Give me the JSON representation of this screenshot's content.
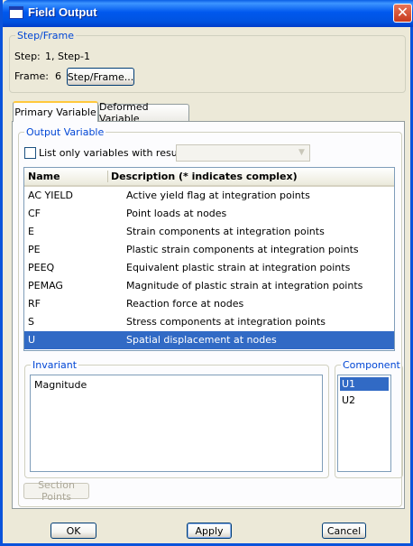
{
  "window": {
    "title": "Field Output",
    "close_glyph": "✕"
  },
  "step_frame": {
    "legend": "Step/Frame",
    "step_label": "Step:",
    "step_value": "1, Step-1",
    "frame_label": "Frame:",
    "frame_value": "6",
    "button": "Step/Frame..."
  },
  "tabs": [
    {
      "label": "Primary Variable",
      "active": true
    },
    {
      "label": "Deformed Variable",
      "active": false
    }
  ],
  "output_variable": {
    "legend": "Output Variable",
    "checkbox_label": "List only variables with results:",
    "checked": false,
    "combo_value": ""
  },
  "table": {
    "columns": [
      "Name",
      "Description (* indicates complex)"
    ],
    "rows": [
      {
        "name": "AC YIELD",
        "desc": "Active yield flag at integration points"
      },
      {
        "name": "CF",
        "desc": "Point loads at nodes"
      },
      {
        "name": "E",
        "desc": "Strain components at integration points"
      },
      {
        "name": "PE",
        "desc": "Plastic strain components at integration points"
      },
      {
        "name": "PEEQ",
        "desc": "Equivalent plastic strain at integration points"
      },
      {
        "name": "PEMAG",
        "desc": "Magnitude of plastic strain at integration points"
      },
      {
        "name": "RF",
        "desc": "Reaction force at nodes"
      },
      {
        "name": "S",
        "desc": "Stress components at integration points"
      },
      {
        "name": "U",
        "desc": "Spatial displacement at nodes"
      }
    ],
    "selected_index": 8
  },
  "invariant": {
    "legend": "Invariant",
    "items": [
      "Magnitude"
    ]
  },
  "component": {
    "legend": "Component",
    "items": [
      "U1",
      "U2"
    ],
    "selected_index": 0
  },
  "section_points_button": "Section Points",
  "footer": {
    "ok": "OK",
    "apply": "Apply",
    "cancel": "Cancel"
  },
  "colors": {
    "titlebar": "#0058EE",
    "selection": "#316AC5",
    "legend_text": "#0046D5",
    "dialog_bg": "#ECE9D8"
  }
}
